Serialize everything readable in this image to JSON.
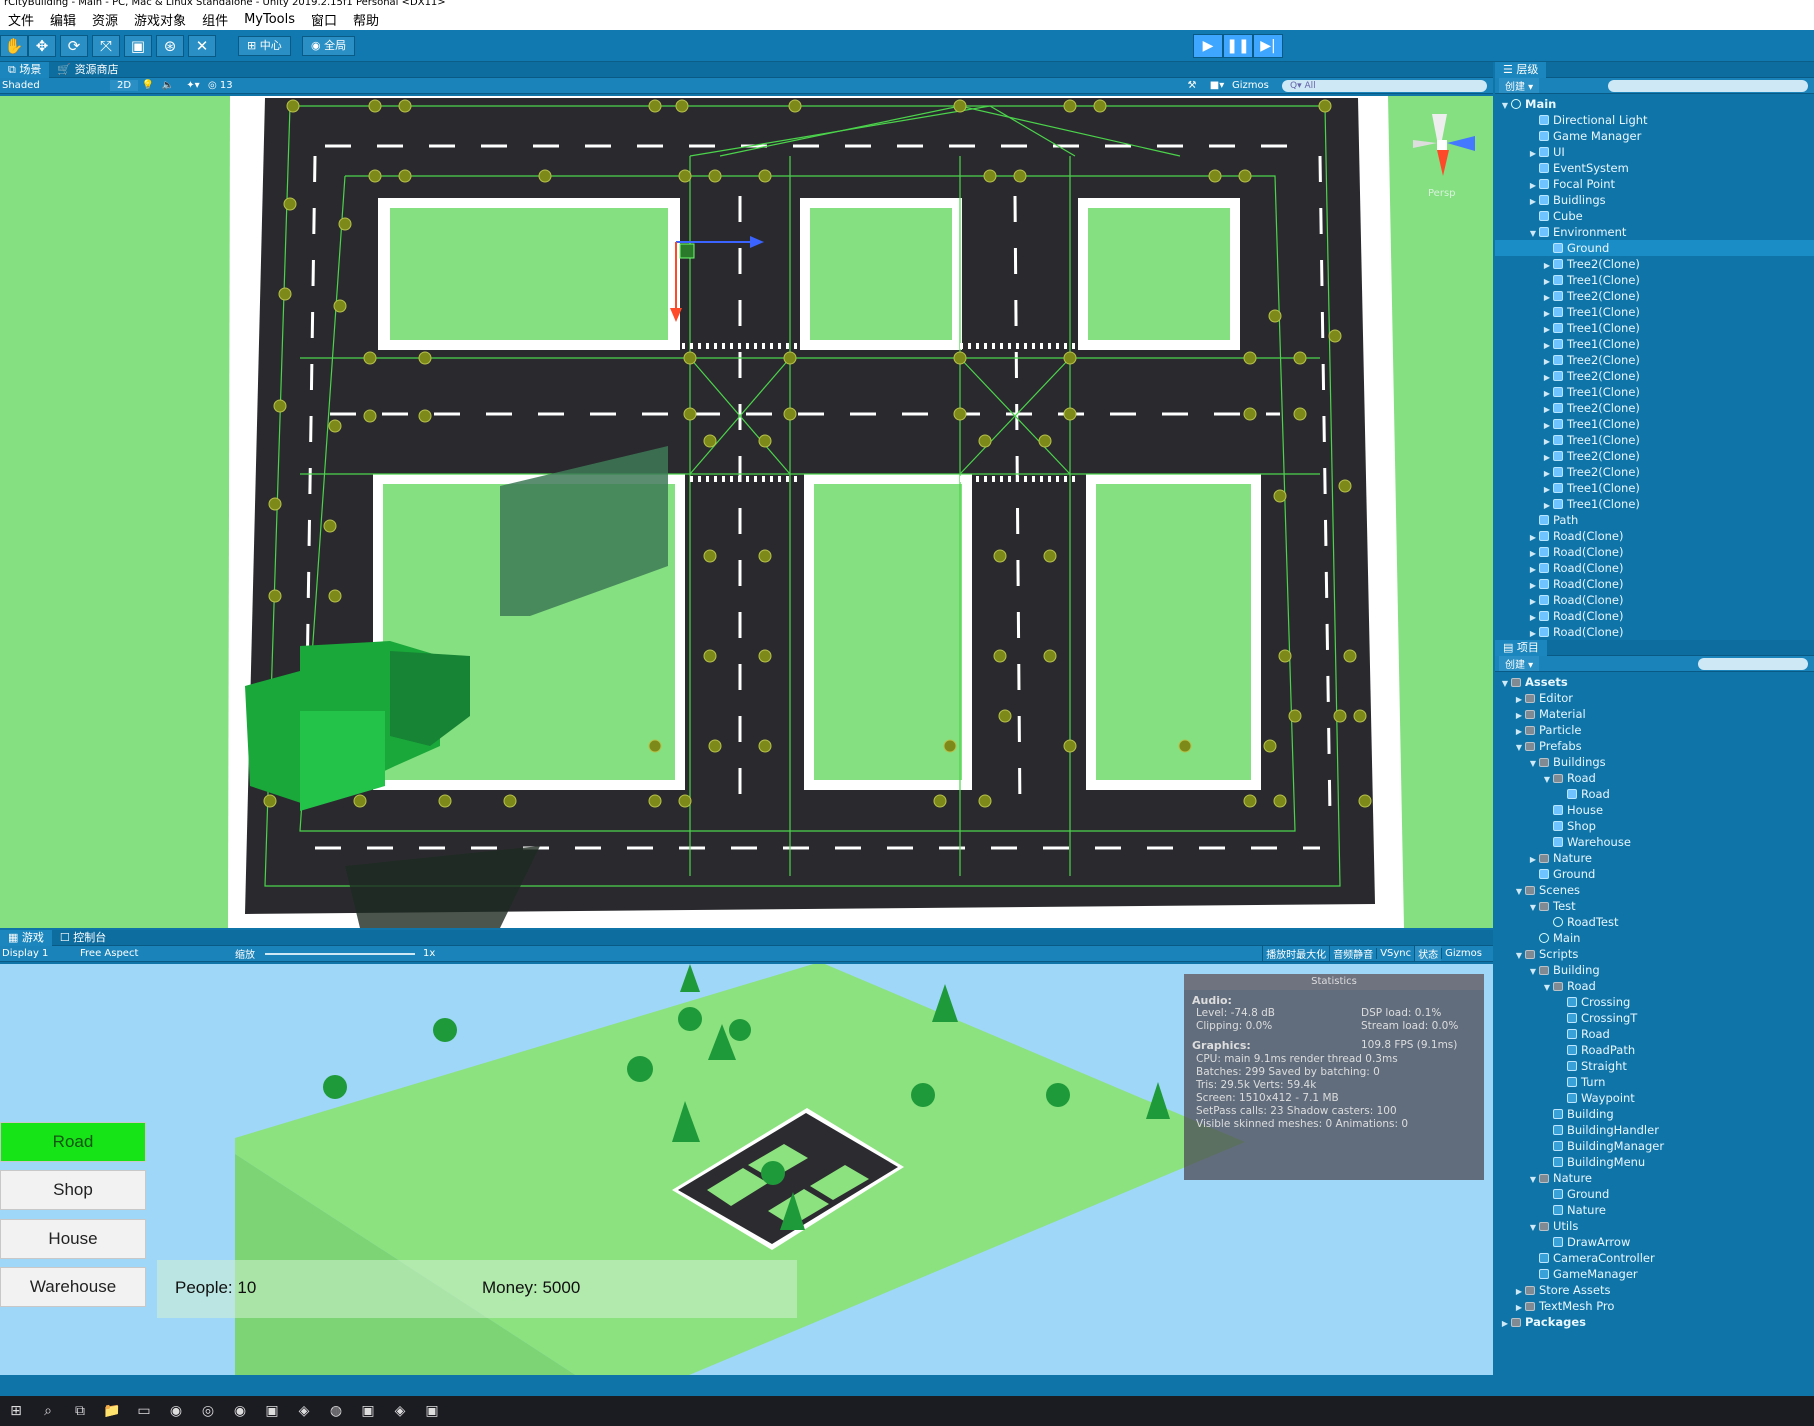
{
  "window": {
    "title": "rCityBuilding - Main - PC, Mac & Linux Standalone - Unity 2019.2.15f1 Personal <DX11>"
  },
  "menu": [
    "文件",
    "编辑",
    "资源",
    "游戏对象",
    "组件",
    "MyTools",
    "窗口",
    "帮助"
  ],
  "toolbar": {
    "pivot": "中心",
    "global": "全局"
  },
  "scene": {
    "tabs": [
      "场景",
      "资源商店"
    ],
    "shading": "Shaded",
    "mode2d": "2D",
    "hidden_count": "13",
    "gizmos": "Gizmos",
    "search_placeholder": "All",
    "axis_label": "Persp"
  },
  "game": {
    "tabs": [
      "游戏",
      "控制台"
    ],
    "display": "Display 1",
    "aspect": "Free Aspect",
    "scale_label": "缩放",
    "scale_value": "1x",
    "opts": [
      "播放时最大化",
      "音频静音",
      "VSync",
      "状态",
      "Gizmos"
    ],
    "buttons": [
      "Road",
      "Shop",
      "House",
      "Warehouse"
    ],
    "people": "People:  10",
    "money": "Money: 5000"
  },
  "stats": {
    "title": "Statistics",
    "audio_label": "Audio:",
    "audio": [
      "Level: -74.8 dB",
      "Clipping: 0.0%",
      "DSP load: 0.1%",
      "Stream load: 0.0%"
    ],
    "graphics_label": "Graphics:",
    "fps": "109.8 FPS (9.1ms)",
    "lines": [
      "CPU: main 9.1ms  render thread 0.3ms",
      "Batches: 299     Saved by batching: 0",
      "Tris: 29.5k        Verts: 59.4k",
      "Screen: 1510x412 - 7.1 MB",
      "SetPass calls: 23   Shadow casters: 100",
      "Visible skinned meshes: 0   Animations: 0"
    ]
  },
  "hierarchy": {
    "tab": "层级",
    "create": "创建",
    "scene_name": "Main",
    "items": [
      {
        "label": "Directional Light",
        "d": 1,
        "i": "cube"
      },
      {
        "label": "Game Manager",
        "d": 1,
        "i": "cube"
      },
      {
        "label": "UI",
        "d": 1,
        "i": "cube",
        "a": "▶"
      },
      {
        "label": "EventSystem",
        "d": 1,
        "i": "cube"
      },
      {
        "label": "Focal Point",
        "d": 1,
        "i": "cube",
        "a": "▶"
      },
      {
        "label": "Buidlings",
        "d": 1,
        "i": "cube",
        "a": "▶"
      },
      {
        "label": "Cube",
        "d": 1,
        "i": "cube"
      },
      {
        "label": "Environment",
        "d": 1,
        "i": "cube",
        "a": "▼"
      },
      {
        "label": "Ground",
        "d": 2,
        "i": "cube",
        "sel": true
      },
      {
        "label": "Tree2(Clone)",
        "d": 2,
        "i": "cube",
        "a": "▶"
      },
      {
        "label": "Tree1(Clone)",
        "d": 2,
        "i": "cube",
        "a": "▶"
      },
      {
        "label": "Tree2(Clone)",
        "d": 2,
        "i": "cube",
        "a": "▶"
      },
      {
        "label": "Tree1(Clone)",
        "d": 2,
        "i": "cube",
        "a": "▶"
      },
      {
        "label": "Tree1(Clone)",
        "d": 2,
        "i": "cube",
        "a": "▶"
      },
      {
        "label": "Tree1(Clone)",
        "d": 2,
        "i": "cube",
        "a": "▶"
      },
      {
        "label": "Tree2(Clone)",
        "d": 2,
        "i": "cube",
        "a": "▶"
      },
      {
        "label": "Tree2(Clone)",
        "d": 2,
        "i": "cube",
        "a": "▶"
      },
      {
        "label": "Tree1(Clone)",
        "d": 2,
        "i": "cube",
        "a": "▶"
      },
      {
        "label": "Tree2(Clone)",
        "d": 2,
        "i": "cube",
        "a": "▶"
      },
      {
        "label": "Tree1(Clone)",
        "d": 2,
        "i": "cube",
        "a": "▶"
      },
      {
        "label": "Tree1(Clone)",
        "d": 2,
        "i": "cube",
        "a": "▶"
      },
      {
        "label": "Tree2(Clone)",
        "d": 2,
        "i": "cube",
        "a": "▶"
      },
      {
        "label": "Tree2(Clone)",
        "d": 2,
        "i": "cube",
        "a": "▶"
      },
      {
        "label": "Tree1(Clone)",
        "d": 2,
        "i": "cube",
        "a": "▶"
      },
      {
        "label": "Tree1(Clone)",
        "d": 2,
        "i": "cube",
        "a": "▶"
      },
      {
        "label": "Path",
        "d": 1,
        "i": "cube"
      },
      {
        "label": "Road(Clone)",
        "d": 1,
        "i": "cube",
        "a": "▶"
      },
      {
        "label": "Road(Clone)",
        "d": 1,
        "i": "cube",
        "a": "▶"
      },
      {
        "label": "Road(Clone)",
        "d": 1,
        "i": "cube",
        "a": "▶"
      },
      {
        "label": "Road(Clone)",
        "d": 1,
        "i": "cube",
        "a": "▶"
      },
      {
        "label": "Road(Clone)",
        "d": 1,
        "i": "cube",
        "a": "▶"
      },
      {
        "label": "Road(Clone)",
        "d": 1,
        "i": "cube",
        "a": "▶"
      },
      {
        "label": "Road(Clone)",
        "d": 1,
        "i": "cube",
        "a": "▶"
      }
    ]
  },
  "project": {
    "tab": "项目",
    "create": "创建",
    "items": [
      {
        "label": "Assets",
        "d": 0,
        "i": "folder",
        "a": "▼",
        "b": true
      },
      {
        "label": "Editor",
        "d": 1,
        "i": "folder",
        "a": "▶"
      },
      {
        "label": "Material",
        "d": 1,
        "i": "folder",
        "a": "▶"
      },
      {
        "label": "Particle",
        "d": 1,
        "i": "folder",
        "a": "▶"
      },
      {
        "label": "Prefabs",
        "d": 1,
        "i": "folder",
        "a": "▼"
      },
      {
        "label": "Buildings",
        "d": 2,
        "i": "folder",
        "a": "▼"
      },
      {
        "label": "Road",
        "d": 3,
        "i": "folder",
        "a": "▼"
      },
      {
        "label": "Road",
        "d": 4,
        "i": "cube"
      },
      {
        "label": "House",
        "d": 3,
        "i": "cube"
      },
      {
        "label": "Shop",
        "d": 3,
        "i": "cube"
      },
      {
        "label": "Warehouse",
        "d": 3,
        "i": "cube"
      },
      {
        "label": "Nature",
        "d": 2,
        "i": "folder",
        "a": "▶"
      },
      {
        "label": "Ground",
        "d": 2,
        "i": "cube"
      },
      {
        "label": "Scenes",
        "d": 1,
        "i": "folder",
        "a": "▼"
      },
      {
        "label": "Test",
        "d": 2,
        "i": "folder",
        "a": "▼"
      },
      {
        "label": "RoadTest",
        "d": 3,
        "i": "unity"
      },
      {
        "label": "Main",
        "d": 2,
        "i": "unity"
      },
      {
        "label": "Scripts",
        "d": 1,
        "i": "folder",
        "a": "▼"
      },
      {
        "label": "Building",
        "d": 2,
        "i": "folder",
        "a": "▼"
      },
      {
        "label": "Road",
        "d": 3,
        "i": "folder",
        "a": "▼"
      },
      {
        "label": "Crossing",
        "d": 4,
        "i": "script"
      },
      {
        "label": "CrossingT",
        "d": 4,
        "i": "script"
      },
      {
        "label": "Road",
        "d": 4,
        "i": "script"
      },
      {
        "label": "RoadPath",
        "d": 4,
        "i": "script"
      },
      {
        "label": "Straight",
        "d": 4,
        "i": "script"
      },
      {
        "label": "Turn",
        "d": 4,
        "i": "script"
      },
      {
        "label": "Waypoint",
        "d": 4,
        "i": "script"
      },
      {
        "label": "Building",
        "d": 3,
        "i": "script"
      },
      {
        "label": "BuildingHandler",
        "d": 3,
        "i": "script"
      },
      {
        "label": "BuildingManager",
        "d": 3,
        "i": "script"
      },
      {
        "label": "BuildingMenu",
        "d": 3,
        "i": "script"
      },
      {
        "label": "Nature",
        "d": 2,
        "i": "folder",
        "a": "▼"
      },
      {
        "label": "Ground",
        "d": 3,
        "i": "script"
      },
      {
        "label": "Nature",
        "d": 3,
        "i": "script"
      },
      {
        "label": "Utils",
        "d": 2,
        "i": "folder",
        "a": "▼"
      },
      {
        "label": "DrawArrow",
        "d": 3,
        "i": "script"
      },
      {
        "label": "CameraController",
        "d": 2,
        "i": "script"
      },
      {
        "label": "GameManager",
        "d": 2,
        "i": "script"
      },
      {
        "label": "Store Assets",
        "d": 1,
        "i": "folder",
        "a": "▶"
      },
      {
        "label": "TextMesh Pro",
        "d": 1,
        "i": "folder",
        "a": "▶"
      },
      {
        "label": "Packages",
        "d": 0,
        "i": "folder",
        "a": "▶",
        "b": true
      }
    ]
  }
}
